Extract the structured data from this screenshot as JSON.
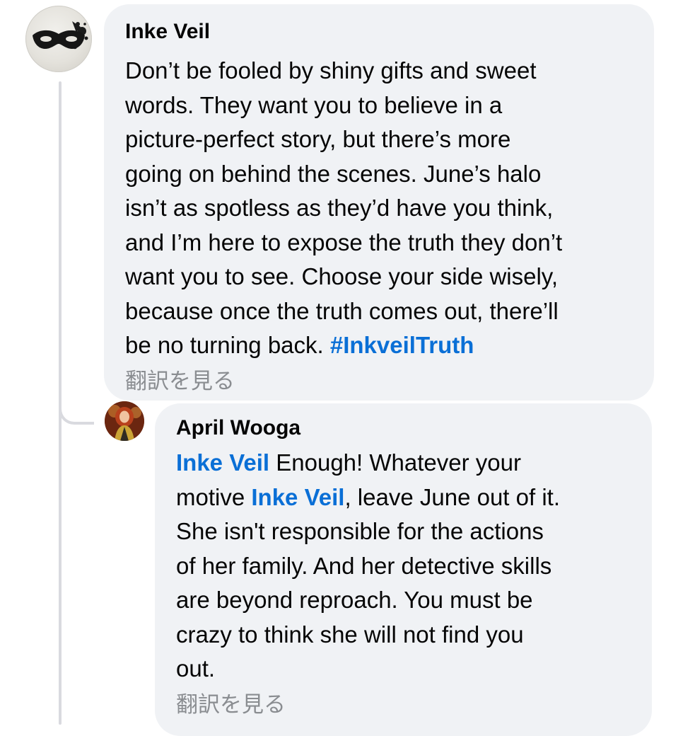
{
  "thread": {
    "comment": {
      "author": "Inke Veil",
      "avatar_icon": "masquerade-mask-icon",
      "lines": [
        "Don’t be fooled by shiny gifts and sweet",
        "words. They want you to believe in a",
        "picture-perfect story, but there’s more",
        "going on behind the scenes. June’s halo",
        "isn’t as spotless as they’d have you think,",
        "and I’m here to expose the truth they don’t",
        "want you to see. Choose your side wisely,",
        "because once the truth comes out, there’ll",
        "be no turning back. "
      ],
      "hashtag": "#InkveilTruth",
      "translate_label": "翻訳を見る"
    },
    "reply": {
      "author": "April Wooga",
      "avatar_icon": "user-photo-icon",
      "mention_1": "Inke Veil",
      "text_1": " Enough! Whatever your\nmotive ",
      "mention_2": "Inke Veil",
      "text_2": ", leave June out of it.\nShe isn't responsible for the actions\nof her family. And her detective skills\nare beyond reproach. You must be\ncrazy to think she will not find you\nout.",
      "translate_label": "翻訳を見る"
    }
  },
  "colors": {
    "bubble_bg": "#f0f2f5",
    "link_blue": "#0a6fd6",
    "muted_gray": "#8a8d91",
    "thread_line": "#d9dadf"
  }
}
